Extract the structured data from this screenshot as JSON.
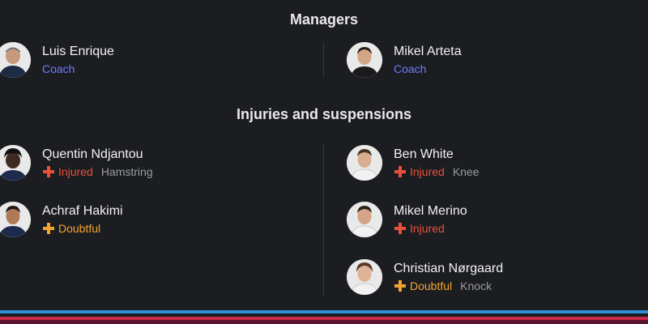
{
  "managers": {
    "title": "Managers",
    "home": {
      "name": "Luis Enrique",
      "role": "Coach"
    },
    "away": {
      "name": "Mikel Arteta",
      "role": "Coach"
    }
  },
  "injuries": {
    "title": "Injuries and suspensions",
    "home": [
      {
        "name": "Quentin Ndjantou",
        "status": "Injured",
        "reason": "Hamstring"
      },
      {
        "name": "Achraf Hakimi",
        "status": "Doubtful",
        "reason": ""
      }
    ],
    "away": [
      {
        "name": "Ben White",
        "status": "Injured",
        "reason": "Knee"
      },
      {
        "name": "Mikel Merino",
        "status": "Injured",
        "reason": ""
      },
      {
        "name": "Christian Nørgaard",
        "status": "Doubtful",
        "reason": "Knock"
      }
    ]
  },
  "colors": {
    "background": "#1c1d21",
    "role": "#6d7cff",
    "injured": "#e8513b",
    "doubtful": "#f0a532",
    "muted": "#9a9ba2"
  },
  "icons": {
    "injured": "red-cross-icon",
    "doubtful": "yellow-cross-icon"
  }
}
